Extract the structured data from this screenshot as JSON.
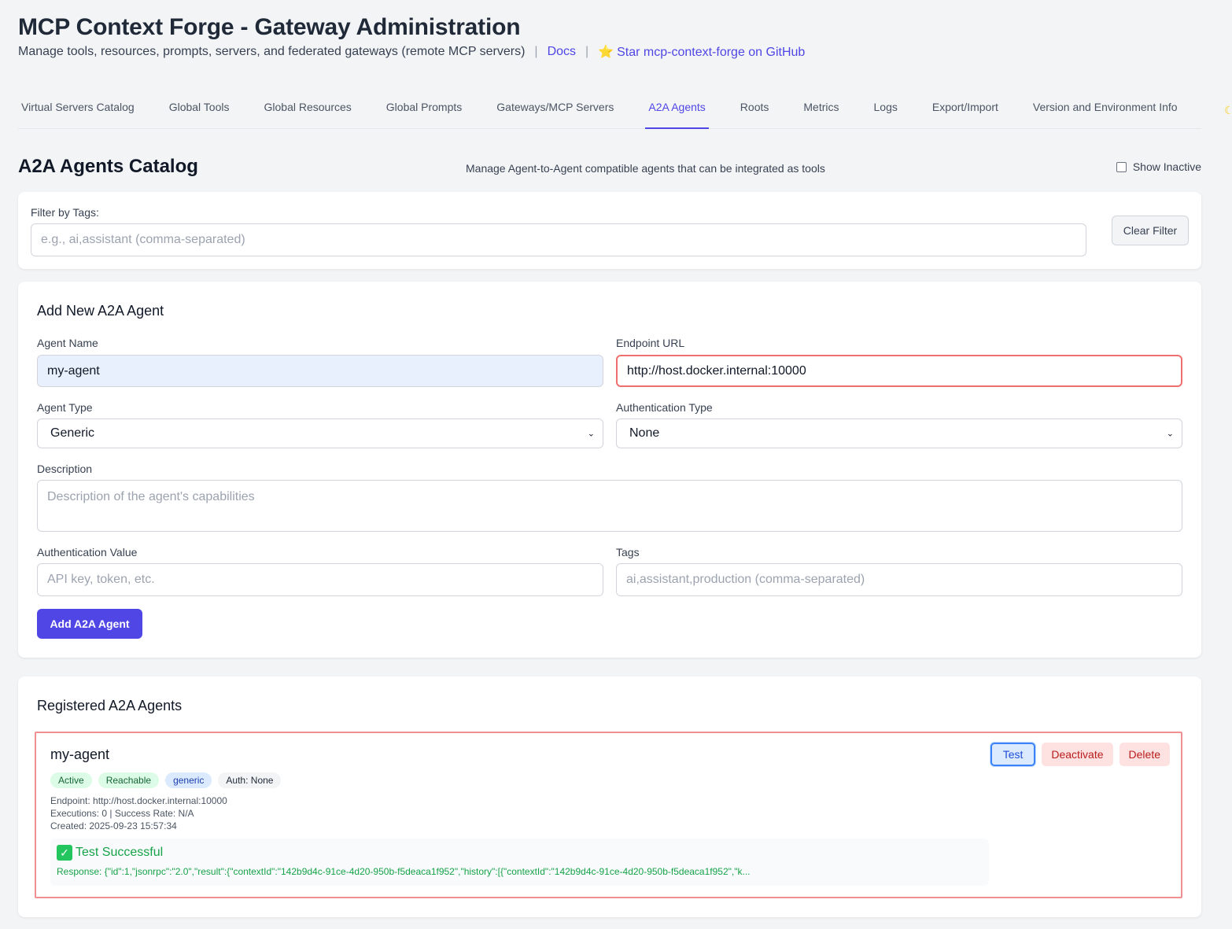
{
  "header": {
    "title": "MCP Context Forge - Gateway Administration",
    "subtitle": "Manage tools, resources, prompts, servers, and federated gateways (remote MCP servers)",
    "separator": "|",
    "docs_link": "Docs",
    "github_star": "⭐",
    "github_link": "Star mcp-context-forge on GitHub"
  },
  "tabs": [
    {
      "label": "Virtual Servers Catalog"
    },
    {
      "label": "Global Tools"
    },
    {
      "label": "Global Resources"
    },
    {
      "label": "Global Prompts"
    },
    {
      "label": "Gateways/MCP Servers"
    },
    {
      "label": "A2A Agents",
      "active": true
    },
    {
      "label": "Roots"
    },
    {
      "label": "Metrics"
    },
    {
      "label": "Logs"
    },
    {
      "label": "Export/Import"
    },
    {
      "label": "Version and Environment Info"
    }
  ],
  "section": {
    "title": "A2A Agents Catalog",
    "description": "Manage Agent-to-Agent compatible agents that can be integrated as tools",
    "show_inactive_label": "Show Inactive",
    "show_inactive_checked": false
  },
  "filter": {
    "label": "Filter by Tags:",
    "placeholder": "e.g., ai,assistant (comma-separated)",
    "value": "",
    "clear_button": "Clear Filter"
  },
  "add_form": {
    "title": "Add New A2A Agent",
    "agent_name_label": "Agent Name",
    "agent_name_value": "my-agent",
    "endpoint_label": "Endpoint URL",
    "endpoint_value": "http://host.docker.internal:10000",
    "agent_type_label": "Agent Type",
    "agent_type_value": "Generic",
    "auth_type_label": "Authentication Type",
    "auth_type_value": "None",
    "description_label": "Description",
    "description_placeholder": "Description of the agent's capabilities",
    "auth_value_label": "Authentication Value",
    "auth_value_placeholder": "API key, token, etc.",
    "tags_label": "Tags",
    "tags_placeholder": "ai,assistant,production (comma-separated)",
    "submit_button": "Add A2A Agent"
  },
  "registered": {
    "title": "Registered A2A Agents",
    "agents": [
      {
        "name": "my-agent",
        "badges": [
          "Active",
          "Reachable",
          "generic",
          "Auth: None"
        ],
        "endpoint": "Endpoint: http://host.docker.internal:10000",
        "executions": "Executions: 0 | Success Rate: N/A",
        "created": "Created: 2025-09-23 15:57:34",
        "test_result_title": "Test Successful",
        "test_result_icon": "✓",
        "test_response": "Response: {\"id\":1,\"jsonrpc\":\"2.0\",\"result\":{\"contextId\":\"142b9d4c-91ce-4d20-950b-f5deaca1f952\",\"history\":[{\"contextId\":\"142b9d4c-91ce-4d20-950b-f5deaca1f952\",\"k...",
        "test_button": "Test",
        "deactivate_button": "Deactivate",
        "delete_button": "Delete"
      }
    ]
  },
  "colors": {
    "accent": "#4f46e5",
    "success": "#16a34a",
    "danger": "#b91c1c",
    "highlight_border": "#ef8f8f"
  }
}
